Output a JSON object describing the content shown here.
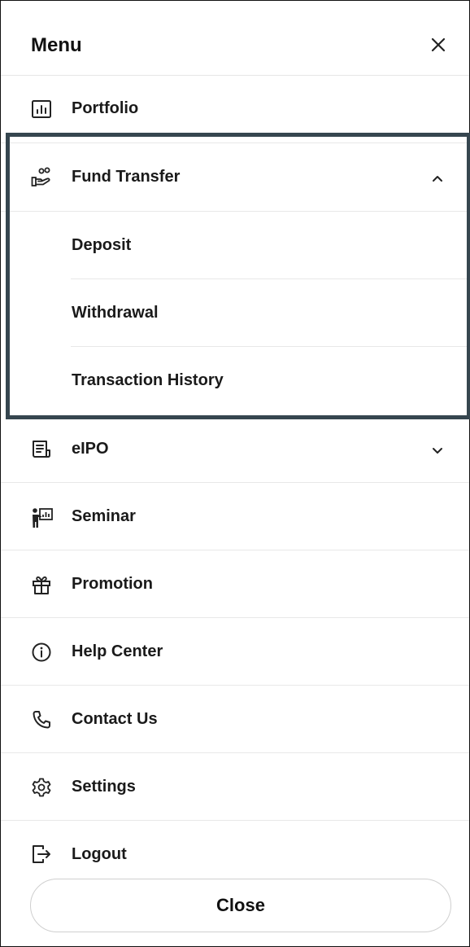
{
  "header": {
    "title": "Menu"
  },
  "menu": {
    "portfolio": "Portfolio",
    "fund_transfer": "Fund Transfer",
    "fund_transfer_sub": [
      "Deposit",
      "Withdrawal",
      "Transaction History"
    ],
    "eipo": "eIPO",
    "seminar": "Seminar",
    "promotion": "Promotion",
    "help_center": "Help Center",
    "contact_us": "Contact Us",
    "settings": "Settings",
    "logout": "Logout"
  },
  "footer": {
    "close_label": "Close"
  },
  "colors": {
    "highlight_border": "#36464f",
    "divider": "#e8e8e8",
    "text": "#1a1a1a"
  }
}
